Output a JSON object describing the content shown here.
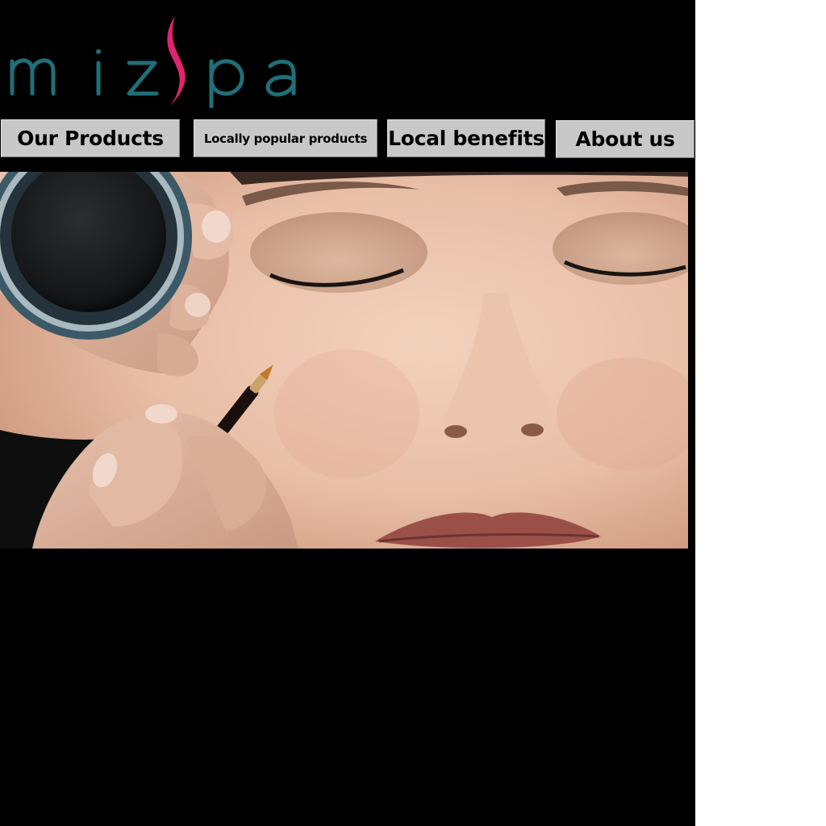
{
  "brand": {
    "logo_text": "miz spa",
    "colors": {
      "logo_teal": "#1f6f78",
      "logo_pink": "#e0246e",
      "background": "#000000",
      "nav_gray": "#c8c8c8"
    }
  },
  "nav": {
    "items": [
      {
        "label": "Our Products"
      },
      {
        "label": "Locally popular products"
      },
      {
        "label": "Local benefits"
      },
      {
        "label": "About us"
      }
    ]
  },
  "hero": {
    "image_subject": "makeup-application-photo"
  }
}
